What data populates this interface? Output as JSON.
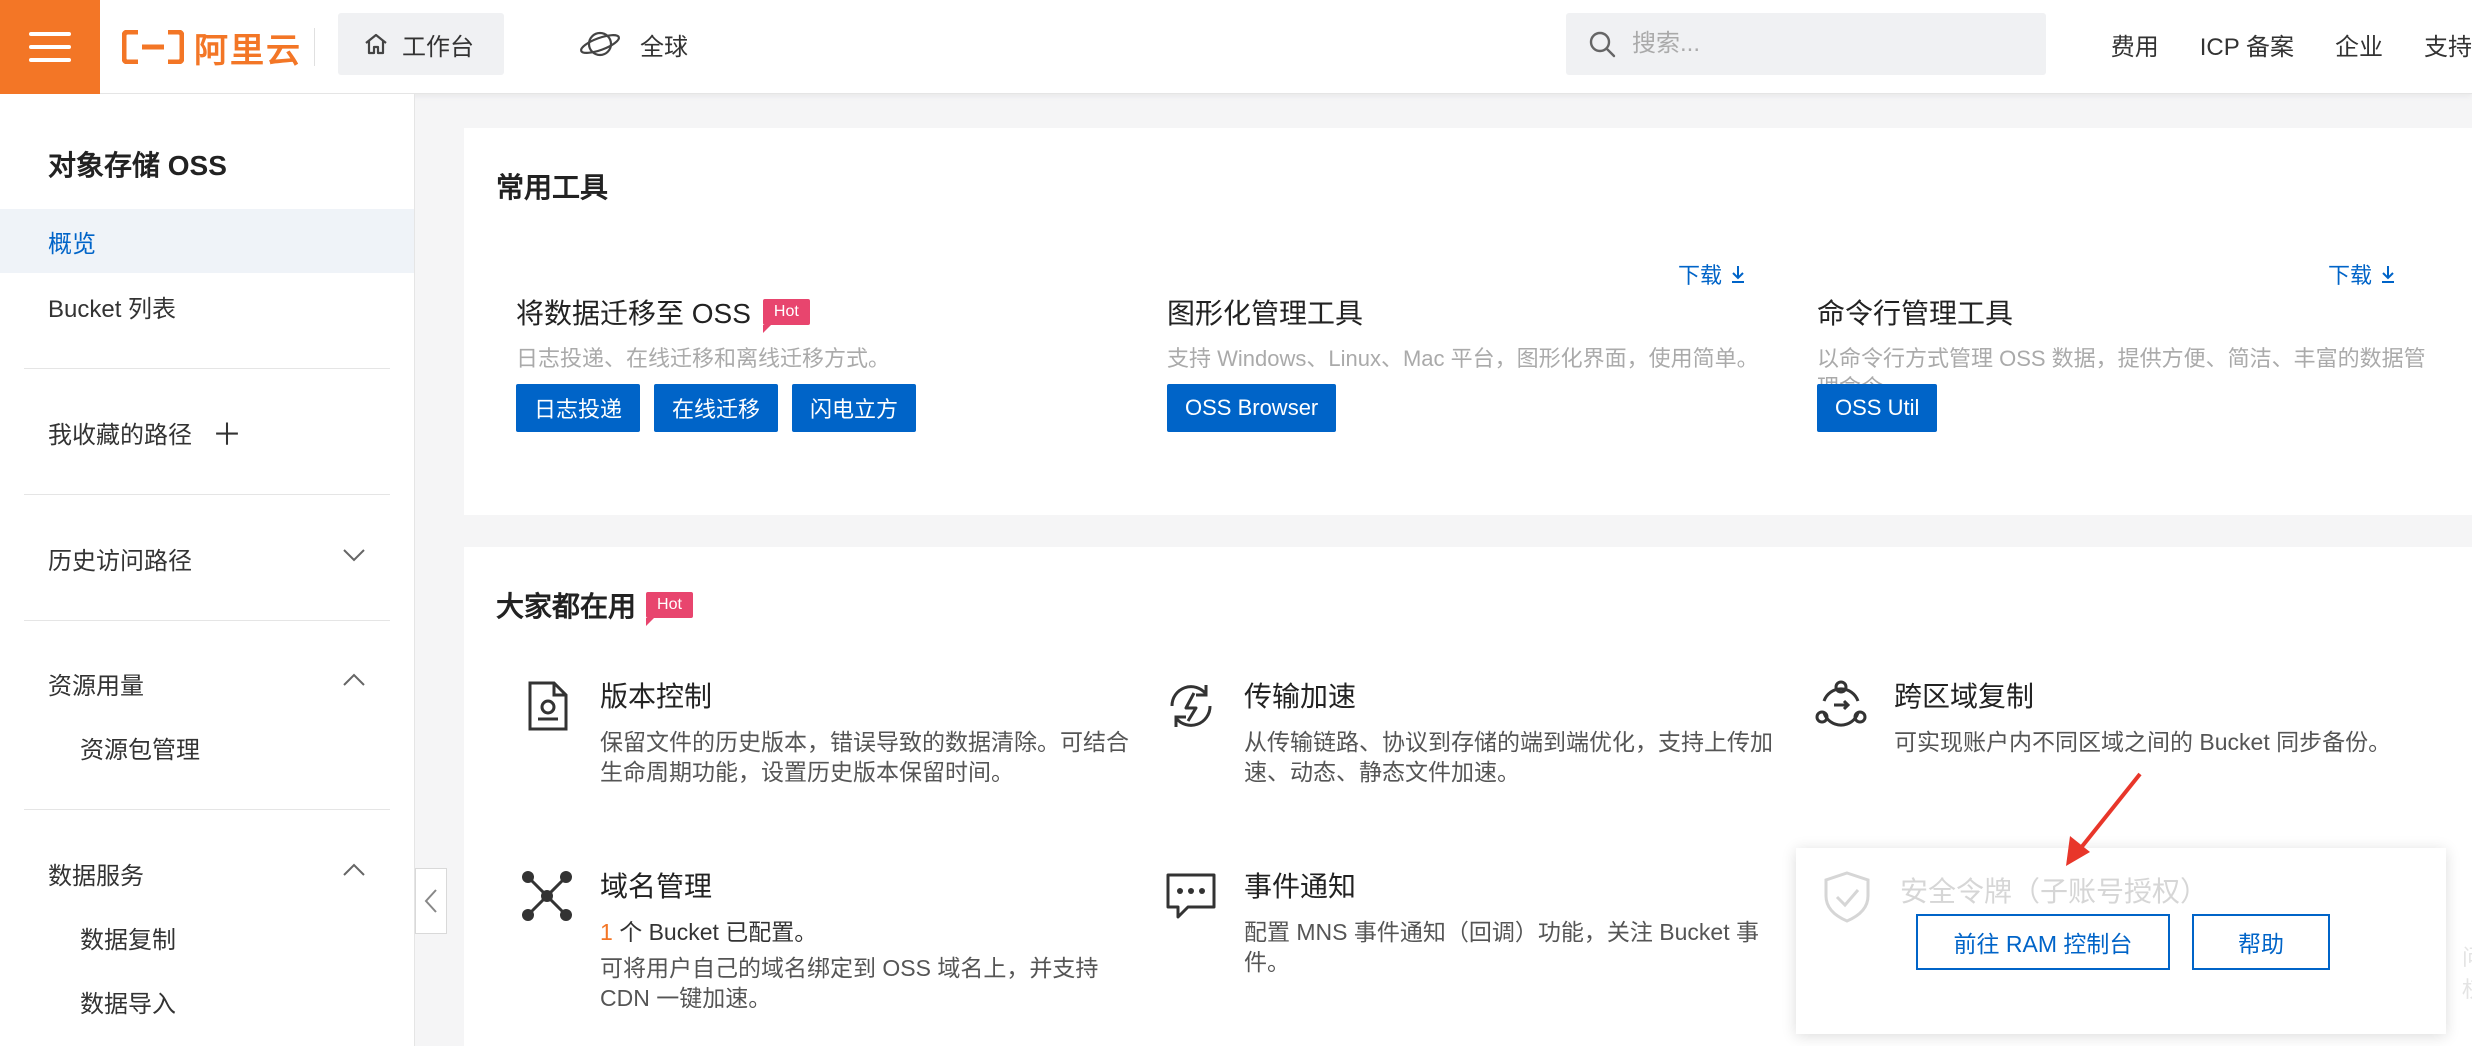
{
  "header": {
    "logo_text": "阿里云",
    "workbench_label": "工作台",
    "region_label": "全球",
    "search_placeholder": "搜索...",
    "links": [
      "费用",
      "ICP 备案",
      "企业",
      "支持"
    ]
  },
  "sidebar": {
    "title": "对象存储 OSS",
    "items": [
      {
        "label": "概览",
        "active": true
      },
      {
        "label": "Bucket 列表"
      },
      {
        "label": "我收藏的路径"
      },
      {
        "label": "历史访问路径"
      },
      {
        "label": "资源用量"
      },
      {
        "label": "资源包管理"
      },
      {
        "label": "数据服务"
      },
      {
        "label": "数据复制"
      },
      {
        "label": "数据导入"
      }
    ]
  },
  "tools_card": {
    "title": "常用工具",
    "hot_badge": "Hot",
    "download_label": "下载",
    "tools": [
      {
        "name": "将数据迁移至 OSS",
        "desc": "日志投递、在线迁移和离线迁移方式。",
        "buttons": [
          "日志投递",
          "在线迁移",
          "闪电立方"
        ]
      },
      {
        "name": "图形化管理工具",
        "desc": "支持 Windows、Linux、Mac 平台，图形化界面，使用简单。",
        "buttons": [
          "OSS Browser"
        ]
      },
      {
        "name": "命令行管理工具",
        "desc": "以命令行方式管理 OSS 数据，提供方便、简洁、丰富的数据管理命令。",
        "buttons": [
          "OSS Util"
        ]
      }
    ]
  },
  "popular_card": {
    "title": "大家都在用",
    "hot_badge": "Hot",
    "features": [
      {
        "name": "版本控制",
        "icon": "version-control-icon",
        "desc": "保留文件的历史版本，错误导致的数据清除。可结合生命周期功能，设置历史版本保留时间。"
      },
      {
        "name": "传输加速",
        "icon": "transfer-acceleration-icon",
        "desc": "从传输链路、协议到存储的端到端优化，支持上传加速、动态、静态文件加速。"
      },
      {
        "name": "跨区域复制",
        "icon": "cross-region-replication-icon",
        "desc": "可实现账户内不同区域之间的 Bucket 同步备份。"
      },
      {
        "name": "域名管理",
        "icon": "domain-management-icon",
        "count": "1",
        "status_suffix": "个 Bucket 已配置。",
        "desc": "可将用户自己的域名绑定到 OSS 域名上，并支持 CDN 一键加速。"
      },
      {
        "name": "事件通知",
        "icon": "event-notification-icon",
        "desc": "配置 MNS 事件通知（回调）功能，关注 Bucket 事件。"
      }
    ]
  },
  "popup": {
    "faded_title": "安全令牌（子账号授权）",
    "faded_desc": "问权",
    "ram_button": "前往 RAM 控制台",
    "help_button": "帮助"
  },
  "colors": {
    "brand_orange": "#f37626",
    "primary_blue": "#0064c8",
    "hot_pink": "#e8456e",
    "annotation_red": "#e8362a"
  }
}
